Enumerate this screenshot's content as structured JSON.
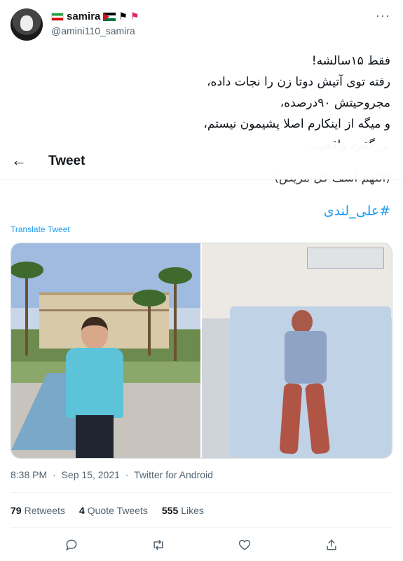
{
  "author": {
    "display_name": "samira",
    "handle": "@amini110_samira",
    "more_label": "···"
  },
  "tweet": {
    "lines": [
      "فقط ۱۵سالشه!",
      "رفته توی آتیش دوتا زن را نجات داده،",
      "مجروحیتش ۹۰درصده،",
      "و میگه از اینکارم اصلا پشیمون نیستم،",
      "بزرگمَرد واقعی.."
    ],
    "hidden_line": "(اللهم اشف کل مریض)",
    "hashtag": "#علی_لندی",
    "translate_label": "Translate Tweet"
  },
  "header": {
    "back_label": "←",
    "title": "Tweet"
  },
  "meta": {
    "time": "8:38 PM",
    "separator": "·",
    "date": "Sep 15, 2021",
    "source": "Twitter for Android"
  },
  "stats": {
    "retweets_count": "79",
    "retweets_label": "Retweets",
    "quotes_count": "4",
    "quotes_label": "Quote Tweets",
    "likes_count": "555",
    "likes_label": "Likes"
  },
  "colors": {
    "accent": "#1d9bf0",
    "muted": "#536471",
    "text": "#0f1419"
  },
  "icons": [
    "reply-icon",
    "retweet-icon",
    "like-icon",
    "share-icon"
  ]
}
